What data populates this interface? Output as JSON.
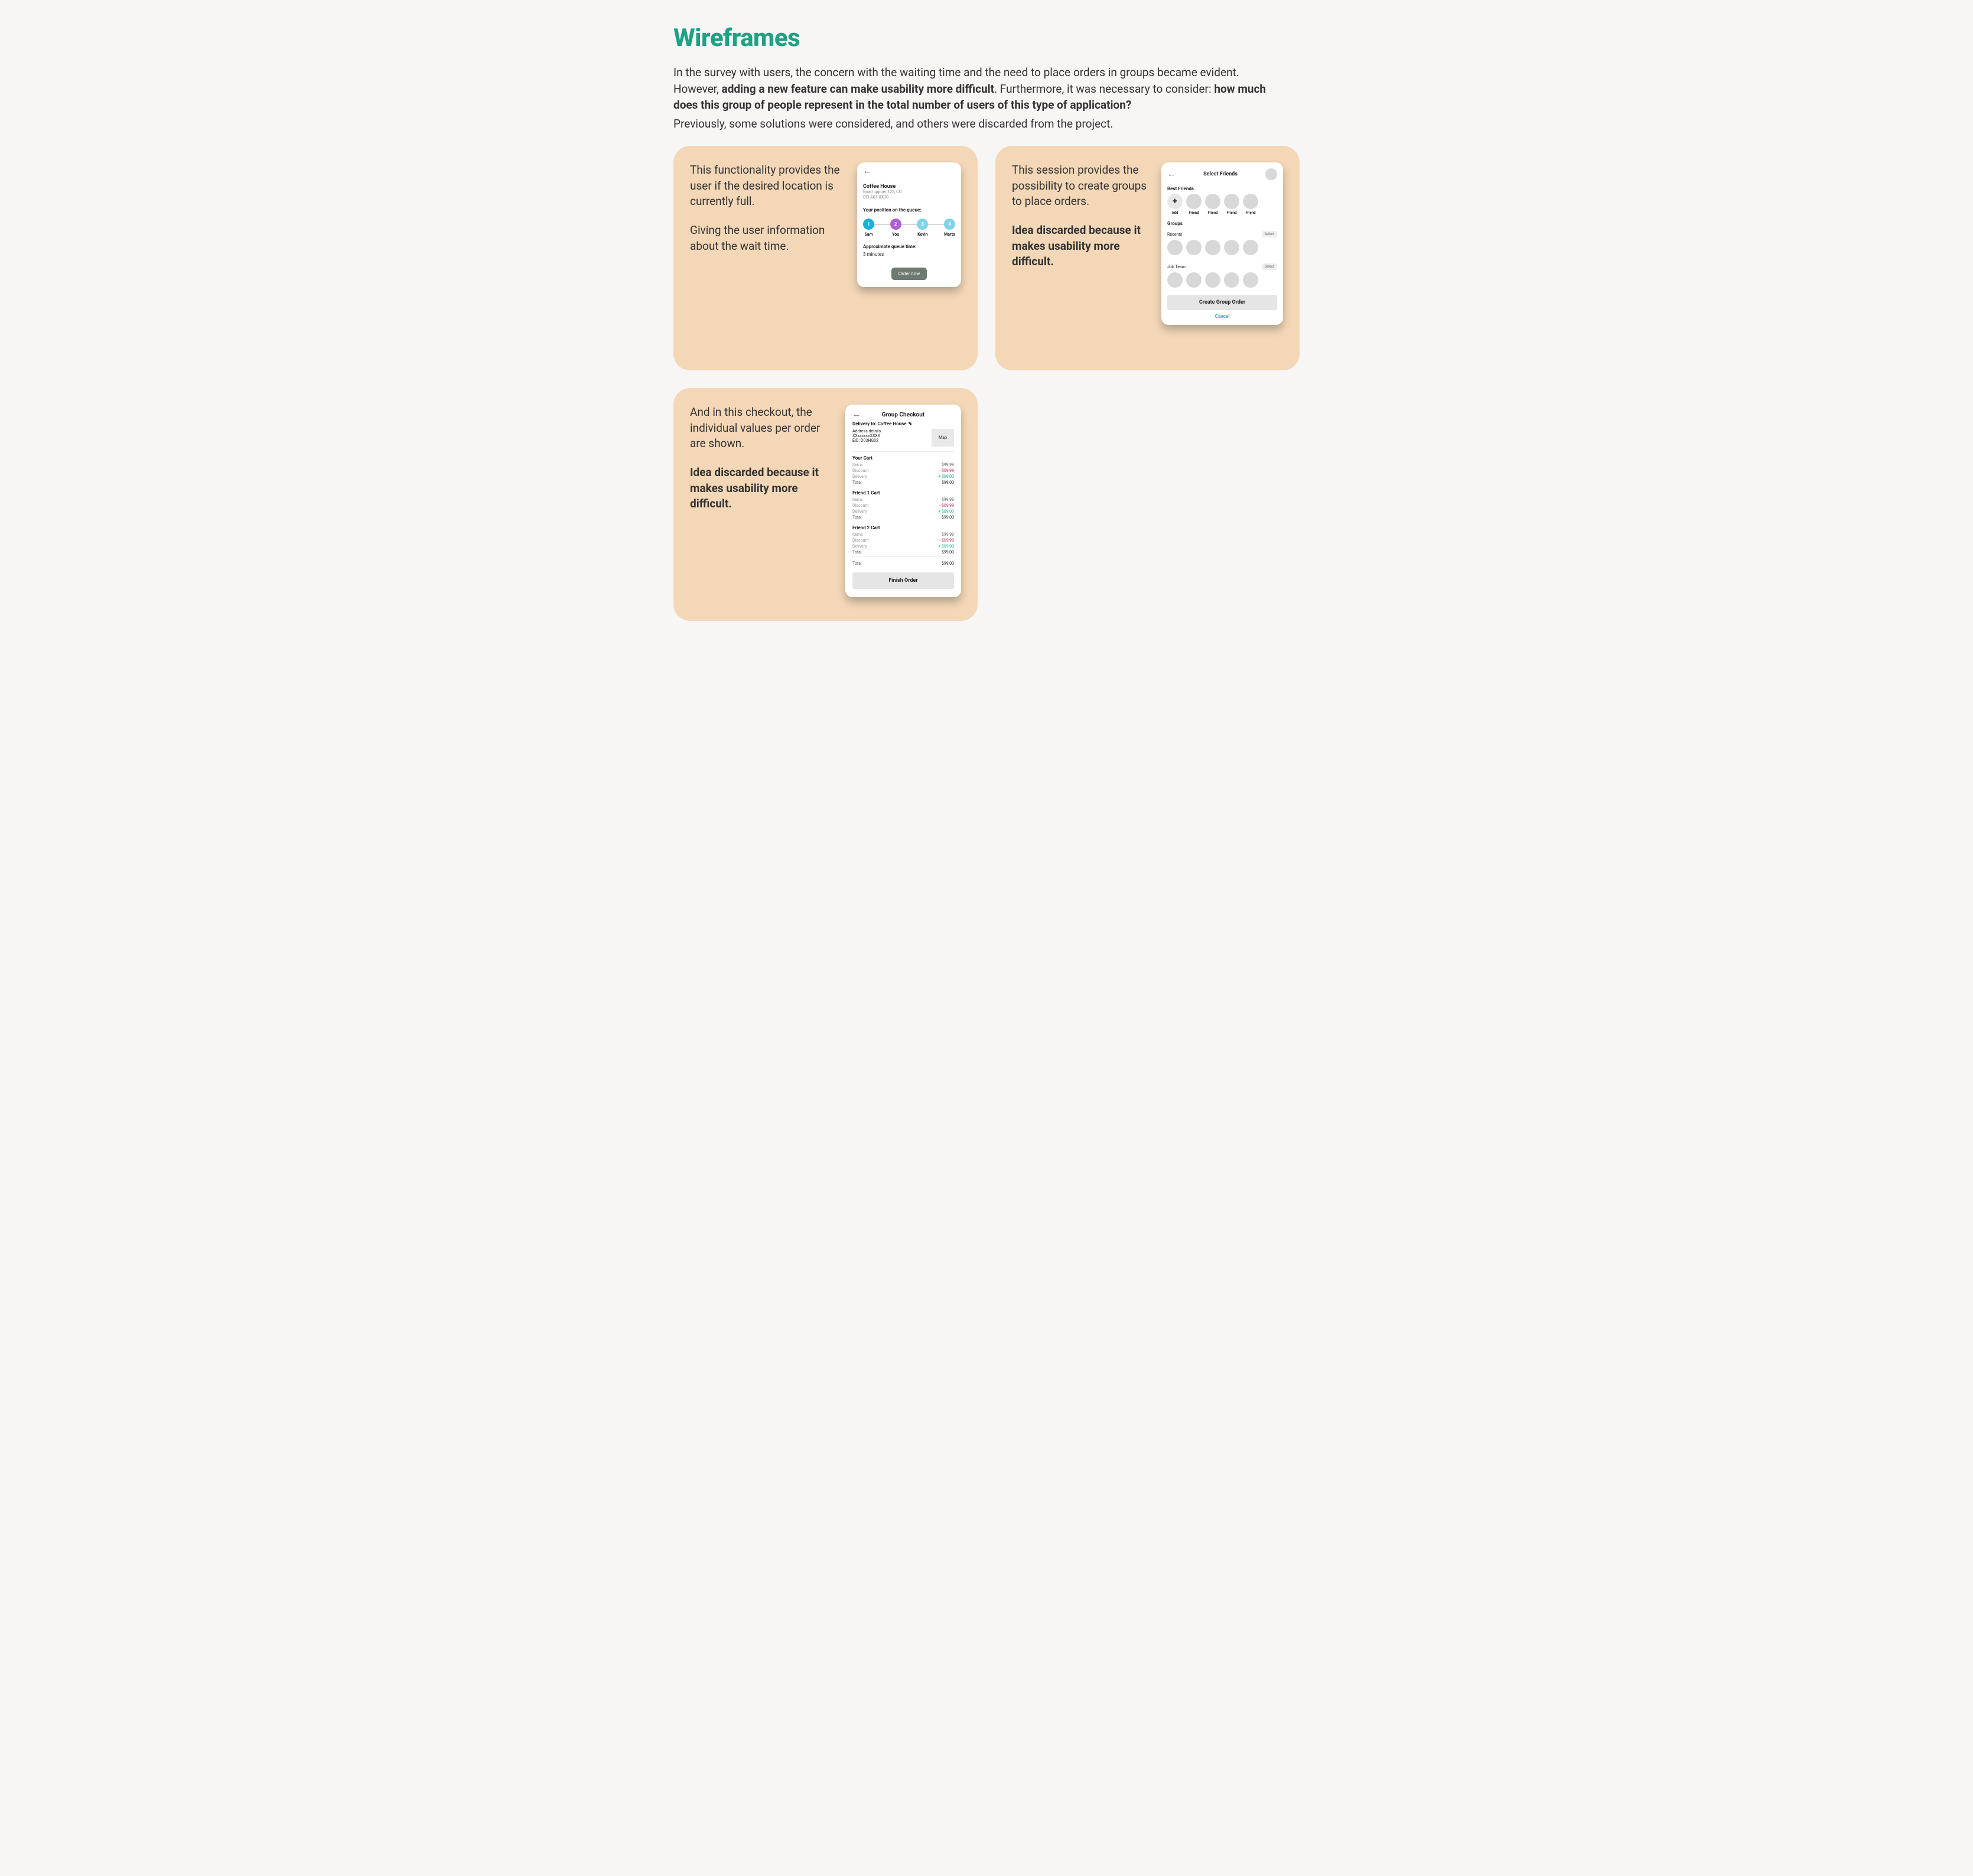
{
  "title": "Wireframes",
  "intro_text_1": "In the survey with users, the concern with the waiting time and the need to place orders in groups became evident. However, ",
  "intro_bold_1": "adding a new feature can make usability more difficult",
  "intro_text_2": ". Furthermore, it was necessary to consider: ",
  "intro_bold_2": "how much does this group of people represent in the total number of users of this type of application?",
  "sub_paragraph": "Previously, some solutions were considered, and others were discarded from the project.",
  "card1": {
    "p1": "This functionality provides the user if the desired location is currently full.",
    "p2": "Giving the user information about the wait time.",
    "phone": {
      "back": "←",
      "store": "Coffee House",
      "addr1": "Road uppper 123, CO",
      "addr2": "EID A01 XX00",
      "queue_heading": "Your position on the queue:",
      "people": [
        {
          "num": "1",
          "name": "Sam",
          "color": "#17b2d6"
        },
        {
          "num": "2",
          "name": "You",
          "color": "#b05fd9"
        },
        {
          "num": "3",
          "name": "Kevin",
          "color": "#7fd3ea"
        },
        {
          "num": "4",
          "name": "Marta",
          "color": "#7fd3ea"
        }
      ],
      "approx_heading": "Approximate queue time:",
      "approx_value": "3 minutes",
      "cta": "Order now"
    }
  },
  "card2": {
    "p1": "This session provides the possibility to create groups to place orders.",
    "discarded": "Idea discarded because it makes usability more difficult.",
    "phone": {
      "back": "←",
      "title": "Select Friends",
      "best_friends_label": "Best Friends",
      "add": "+",
      "bf_items": [
        "Add",
        "Friend",
        "Friend",
        "Friend",
        "Friend"
      ],
      "groups_label": "Groups",
      "group1": "Recents",
      "group2": "Job Team",
      "select_label": "Select",
      "cta": "Create Group Order",
      "cancel": "Cancel"
    }
  },
  "card3": {
    "p1": "And in this checkout, the individual values per order are shown.",
    "discarded": "Idea discarded because it makes usability more difficult.",
    "phone": {
      "back": "←",
      "title": "Group Checkout",
      "deliver_label": "Delivery to: Coffee House",
      "addr_label": "Address details",
      "addr_mask": "XXxxxxxxXXXX",
      "eid": "EID: D03HG02",
      "map": "Map",
      "carts": [
        {
          "name": "Your Cart",
          "items": "$99,99",
          "discount": "- $09,99",
          "delivery": "+ $09,00",
          "total": "$99,00"
        },
        {
          "name": "Friend 1 Cart",
          "items": "$99,99",
          "discount": "- $09,99",
          "delivery": "+ $09,00",
          "total": "$99,00"
        },
        {
          "name": "Friend 2 Cart",
          "items": "$99,99",
          "discount": "- $09,99",
          "delivery": "+ $09,00",
          "total": "$99,00"
        }
      ],
      "labels": {
        "items": "Items",
        "discount": "Discount",
        "delivery": "Delivery",
        "total": "Total"
      },
      "grand_total_label": "Total",
      "grand_total": "$99,00",
      "cta": "Finish Order"
    }
  }
}
